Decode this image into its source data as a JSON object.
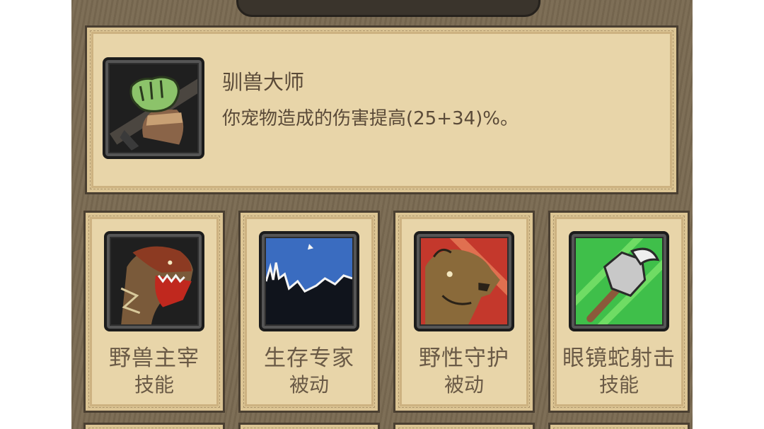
{
  "detail": {
    "title": "驯兽大师",
    "description": "你宠物造成的伤害提高(25+34)%。",
    "icon": "fist-icon"
  },
  "skills": [
    {
      "name": "野兽主宰",
      "type": "技能",
      "icon": "raptor-icon"
    },
    {
      "name": "生存专家",
      "type": "被动",
      "icon": "wolf-silhouette-icon"
    },
    {
      "name": "野性守护",
      "type": "被动",
      "icon": "bear-icon"
    },
    {
      "name": "眼镜蛇射击",
      "type": "技能",
      "icon": "axe-icon"
    }
  ]
}
